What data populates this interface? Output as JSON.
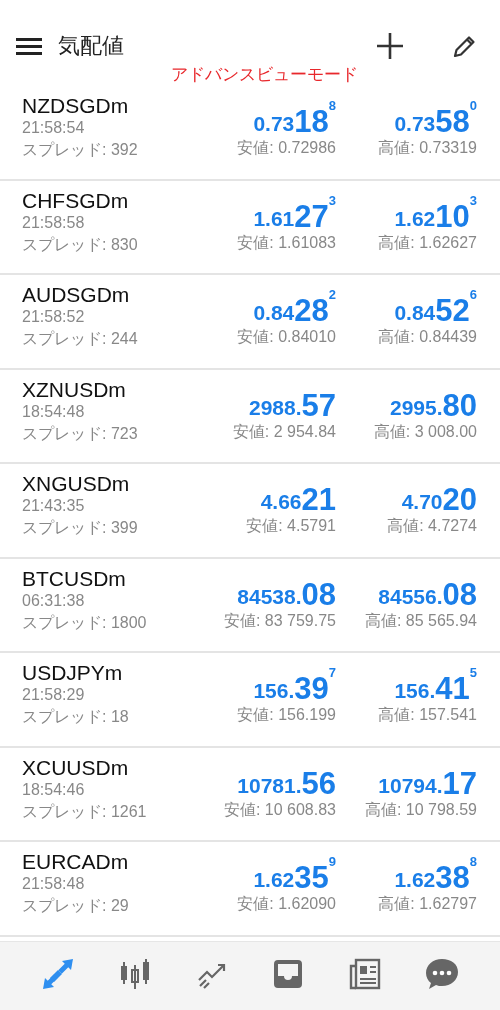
{
  "header": {
    "title": "気配値",
    "mode_label": "アドバンスビューモード"
  },
  "quotes": [
    {
      "symbol": "NZDSGDm",
      "time": "21:58:54",
      "spread": "スプレッド: 392",
      "bid": {
        "prefix": "0.73",
        "big": "18",
        "sup": "8"
      },
      "ask": {
        "prefix": "0.73",
        "big": "58",
        "sup": "0"
      },
      "low": "安値: 0.72986",
      "high": "高値: 0.73319"
    },
    {
      "symbol": "CHFSGDm",
      "time": "21:58:58",
      "spread": "スプレッド: 830",
      "bid": {
        "prefix": "1.61",
        "big": "27",
        "sup": "3"
      },
      "ask": {
        "prefix": "1.62",
        "big": "10",
        "sup": "3"
      },
      "low": "安値: 1.61083",
      "high": "高値: 1.62627"
    },
    {
      "symbol": "AUDSGDm",
      "time": "21:58:52",
      "spread": "スプレッド: 244",
      "bid": {
        "prefix": "0.84",
        "big": "28",
        "sup": "2"
      },
      "ask": {
        "prefix": "0.84",
        "big": "52",
        "sup": "6"
      },
      "low": "安値: 0.84010",
      "high": "高値: 0.84439"
    },
    {
      "symbol": "XZNUSDm",
      "time": "18:54:48",
      "spread": "スプレッド: 723",
      "bid": {
        "prefix": "2988.",
        "big": "57"
      },
      "ask": {
        "prefix": "2995.",
        "big": "80"
      },
      "low": "安値: 2 954.84",
      "high": "高値: 3 008.00"
    },
    {
      "symbol": "XNGUSDm",
      "time": "21:43:35",
      "spread": "スプレッド: 399",
      "bid": {
        "prefix": "4.66",
        "big": "21"
      },
      "ask": {
        "prefix": "4.70",
        "big": "20"
      },
      "low": "安値: 4.5791",
      "high": "高値: 4.7274"
    },
    {
      "symbol": "BTCUSDm",
      "time": "06:31:38",
      "spread": "スプレッド: 1800",
      "bid": {
        "prefix": "84538.",
        "big": "08"
      },
      "ask": {
        "prefix": "84556.",
        "big": "08"
      },
      "low": "安値: 83 759.75",
      "high": "高値: 85 565.94"
    },
    {
      "symbol": "USDJPYm",
      "time": "21:58:29",
      "spread": "スプレッド: 18",
      "bid": {
        "prefix": "156.",
        "big": "39",
        "sup": "7"
      },
      "ask": {
        "prefix": "156.",
        "big": "41",
        "sup": "5"
      },
      "low": "安値: 156.199",
      "high": "高値: 157.541"
    },
    {
      "symbol": "XCUUSDm",
      "time": "18:54:46",
      "spread": "スプレッド: 1261",
      "bid": {
        "prefix": "10781.",
        "big": "56"
      },
      "ask": {
        "prefix": "10794.",
        "big": "17"
      },
      "low": "安値: 10 608.83",
      "high": "高値: 10 798.59"
    },
    {
      "symbol": "EURCADm",
      "time": "21:58:48",
      "spread": "スプレッド: 29",
      "bid": {
        "prefix": "1.62",
        "big": "35",
        "sup": "9"
      },
      "ask": {
        "prefix": "1.62",
        "big": "38",
        "sup": "8"
      },
      "low": "安値: 1.62090",
      "high": "高値: 1.62797"
    }
  ],
  "bottom_nav": [
    {
      "selected": true
    },
    {
      "selected": false
    },
    {
      "selected": false
    },
    {
      "selected": false
    },
    {
      "selected": false
    },
    {
      "selected": false
    }
  ]
}
